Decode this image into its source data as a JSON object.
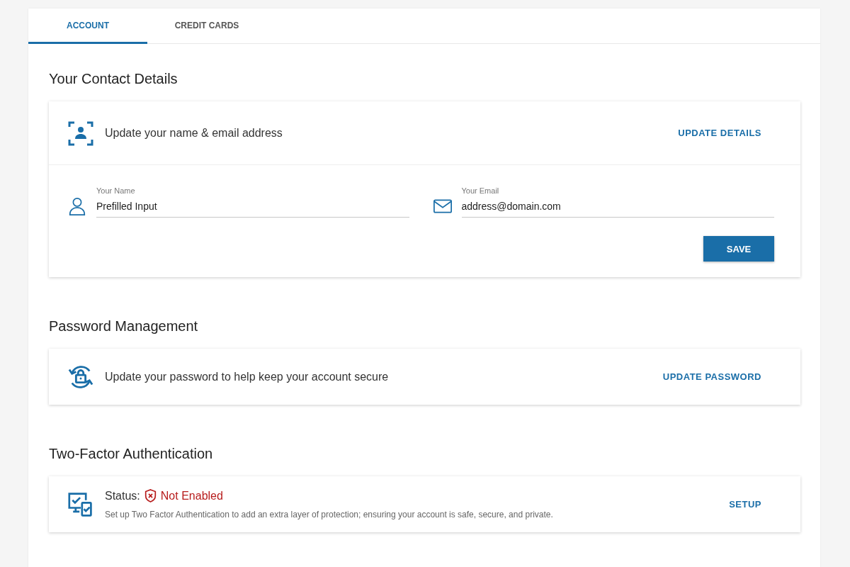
{
  "tabs": [
    {
      "label": "ACCOUNT",
      "selected": true
    },
    {
      "label": "CREDIT CARDS",
      "selected": false
    }
  ],
  "sections": [
    {
      "kind": "contact",
      "title": "Your Contact Details",
      "description": "Update your name & email address",
      "action": "UPDATE DETAILS",
      "fields": [
        {
          "kind": "person",
          "label": "Your Name",
          "value": "Prefilled Input"
        },
        {
          "kind": "email",
          "label": "Your Email",
          "value": "address@domain.com"
        }
      ],
      "save": "SAVE"
    },
    {
      "kind": "password",
      "title": "Password Management",
      "description": "Update your password to help keep your account secure",
      "action": "UPDATE PASSWORD"
    },
    {
      "kind": "twofactor",
      "title": "Two-Factor Authentication",
      "status_label": "Status:",
      "status": "Not Enabled",
      "enabled": false,
      "description": "Set up Two Factor Authentication to add an extra layer of protection; ensuring your account is safe, secure, and private.",
      "action": "SETUP"
    }
  ]
}
